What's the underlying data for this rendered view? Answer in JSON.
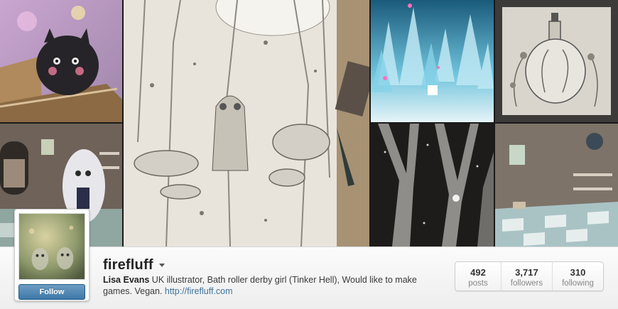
{
  "mosaic": {
    "photos": [
      {
        "icon": "black-fluffy-creature-in-box-photo"
      },
      {
        "icon": "ghost-in-dollhouse-room-photo"
      },
      {
        "icon": "pencil-sketch-mushroom-forest-photo"
      },
      {
        "icon": "ice-crystal-landscape-photo"
      },
      {
        "icon": "bottle-with-plants-sketch-photo"
      },
      {
        "icon": "dark-trees-night-photo"
      },
      {
        "icon": "tiled-room-with-shelves-photo"
      }
    ]
  },
  "profile": {
    "username": "firefluff",
    "follow_label": "Follow",
    "full_name": "Lisa Evans",
    "bio_text": " UK illustrator, Bath roller derby girl (Tinker Hell), Would like to make games. Vegan. ",
    "website": "http://firefluff.com"
  },
  "stats": [
    {
      "value": "492",
      "label": "posts"
    },
    {
      "value": "3,717",
      "label": "followers"
    },
    {
      "value": "310",
      "label": "following"
    }
  ],
  "colors": {
    "follow_button": "#3d78a8",
    "link": "#3f729b",
    "username": "#222222"
  }
}
